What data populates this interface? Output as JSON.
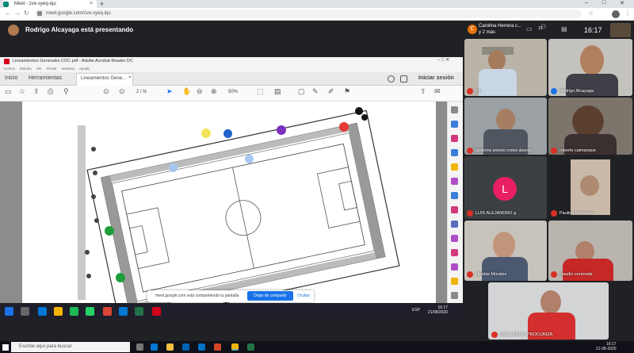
{
  "browser": {
    "tab_title": "Meet - zve-syeq-iqu",
    "url": "meet.google.com/zve-syeq-iqu"
  },
  "meet": {
    "presenting_text": "Rodrigo Alcayaga está presentando",
    "side_title": "Carolina Herrera c...\ny 2 más",
    "people_count": "13",
    "clock": "16:17",
    "participants": [
      {
        "name": "Tú",
        "mic": "red"
      },
      {
        "name": "Rodrigo Alcayaga",
        "mic": "blue"
      },
      {
        "name": "guillermo antonio cortes abarca",
        "mic": "red"
      },
      {
        "name": "roberto caimanque",
        "mic": "red"
      },
      {
        "name": "LUIS ALEJANDRO g",
        "mic": "red",
        "initial": "L"
      },
      {
        "name": "Paulina Bassaure",
        "mic": "red"
      },
      {
        "name": "Nicolas Morales",
        "mic": "red"
      },
      {
        "name": "claudio cereceda",
        "mic": "red"
      },
      {
        "name": "GUILLERMO PROCURIZA",
        "mic": "red"
      }
    ]
  },
  "acrobat": {
    "window_title": "Lineamientos Generales CDC.pdf - Adobe Acrobat Reader DC",
    "menu": [
      "Archivo",
      "Edición",
      "Ver",
      "Firmar",
      "Ventana",
      "Ayuda"
    ],
    "tabs": [
      "Inicio",
      "Herramientas",
      "Lineamientos Gene..."
    ],
    "signin": "Iniciar sesión",
    "page_indicator": "2 / N",
    "zoom": "50%"
  },
  "share_bar": {
    "text": "meet.google.com está compartiendo tu pantalla",
    "stop_label": "Dejar de compartir",
    "hide_label": "Ocultar"
  },
  "inner_taskbar": {
    "lang": "ESP",
    "time": "16:17\n21/08/2020"
  },
  "windows": {
    "search_placeholder": "Escribe aquí para buscar",
    "time": "16:17\n21-08-2020"
  },
  "colors": {
    "marker_red": "#e53935",
    "marker_yellow": "#f2e35a",
    "marker_blue": "#1e63c8",
    "marker_purple": "#7b2fbe",
    "marker_lightblue": "#a6c8f0",
    "marker_green": "#1e9e3a",
    "meet_blue": "#1a73e8"
  }
}
